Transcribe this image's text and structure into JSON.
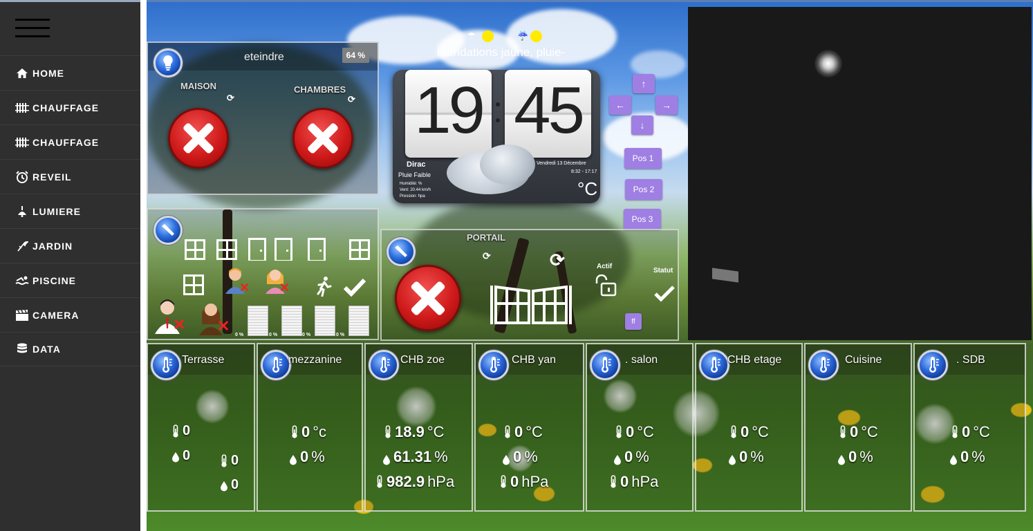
{
  "sidebar": {
    "items": [
      {
        "label": "HOME",
        "icon": "home-icon"
      },
      {
        "label": "CHAUFFAGE",
        "icon": "radiator-icon"
      },
      {
        "label": "CHAUFFAGE",
        "icon": "radiator-icon"
      },
      {
        "label": "REVEIL",
        "icon": "alarm-clock-icon"
      },
      {
        "label": "LUMIERE",
        "icon": "lamp-icon"
      },
      {
        "label": "JARDIN",
        "icon": "garden-tool-icon"
      },
      {
        "label": "PISCINE",
        "icon": "swimmer-icon"
      },
      {
        "label": "CAMERA",
        "icon": "clapperboard-icon"
      },
      {
        "label": "DATA",
        "icon": "database-icon"
      }
    ]
  },
  "weather_alert": {
    "text": "Inondations jaune, pluie-",
    "dots": "- - - -"
  },
  "light_panel": {
    "title": "eteindre",
    "badge": "64 %",
    "maison_label": "MAISON",
    "chambres_label": "CHAMBRES"
  },
  "clock": {
    "hours": "19",
    "minutes": "45",
    "city": "Dirac",
    "condition": "Pluie Faible",
    "humidity": "Humidité: %",
    "wind": "Vent: 20.44 km/h",
    "pressure": "Pression: hpa",
    "date": "Vendredi 13 Décembre",
    "sun": "8:32 - 17:17",
    "temp_unit": "°C"
  },
  "camera_controls": {
    "pos1": "Pos 1",
    "pos2": "Pos 2",
    "pos3": "Pos 3"
  },
  "openings": {
    "shutters": [
      "0 %",
      "0 %",
      "0 %",
      "0 %"
    ]
  },
  "portail": {
    "title": "PORTAIL",
    "actif_label": "Actif",
    "statut_label": "Statut",
    "ff_label": "ff"
  },
  "sensors": [
    {
      "name": "Terrasse",
      "temp": "0",
      "temp_unit": "",
      "hum": "0",
      "hum_unit": "",
      "extra_temp": "0",
      "extra_hum": "0"
    },
    {
      "name": "mezzanine",
      "temp": "0",
      "temp_unit": "°c",
      "hum": "0",
      "hum_unit": "%"
    },
    {
      "name": "CHB zoe",
      "temp": "18.9",
      "temp_unit": "°C",
      "hum": "61.31",
      "hum_unit": "%",
      "press": "982.9",
      "press_unit": "hPa"
    },
    {
      "name": "CHB yan",
      "temp": "0",
      "temp_unit": "°C",
      "hum": "0",
      "hum_unit": "%",
      "press": "0",
      "press_unit": "hPa"
    },
    {
      "name": ". salon",
      "temp": "0",
      "temp_unit": "°C",
      "hum": "0",
      "hum_unit": "%",
      "press": "0",
      "press_unit": "hPa"
    },
    {
      "name": "CHB etage",
      "temp": "0",
      "temp_unit": "°C",
      "hum": "0",
      "hum_unit": "%"
    },
    {
      "name": "Cuisine",
      "temp": "0",
      "temp_unit": "°C",
      "hum": "0",
      "hum_unit": "%"
    },
    {
      "name": ". SDB",
      "temp": "0",
      "temp_unit": "°C",
      "hum": "0",
      "hum_unit": "%"
    }
  ],
  "colors": {
    "sidebar": "#2f2f2f",
    "accent_button": "#9f7fe3",
    "alert_dot": "#ffea00",
    "off_button": "#cf1a1a"
  }
}
